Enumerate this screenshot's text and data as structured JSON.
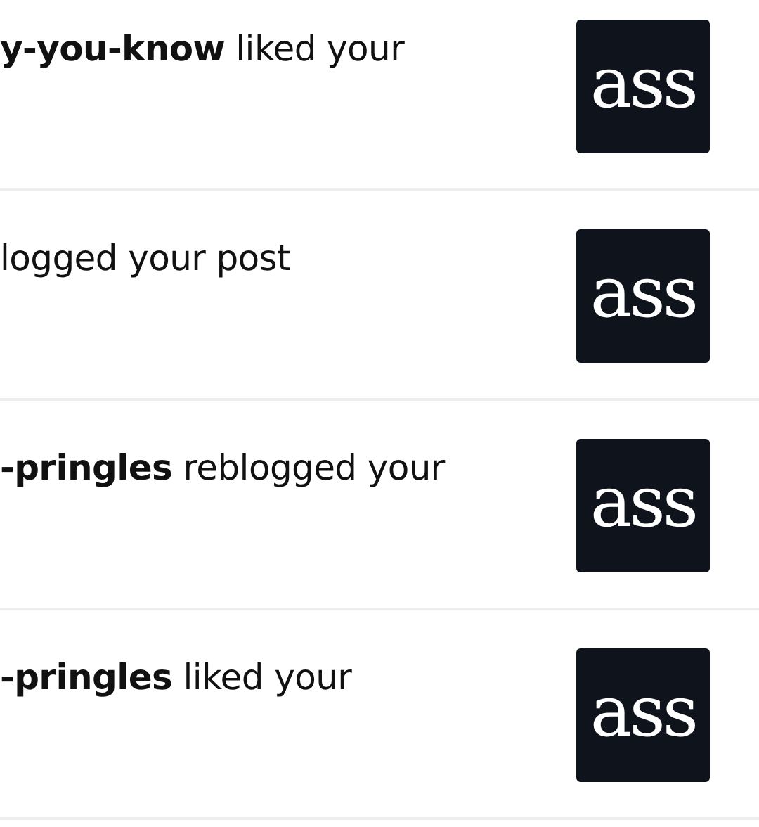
{
  "notifications": [
    {
      "text": "**y-you-know** liked your",
      "thumbnail": "ass"
    },
    {
      "text": "logged your post",
      "thumbnail": "ass"
    },
    {
      "text": "**-pringles** reblogged your",
      "thumbnail": "ass"
    },
    {
      "text": "**-pringles** liked your",
      "thumbnail": "ass"
    }
  ]
}
